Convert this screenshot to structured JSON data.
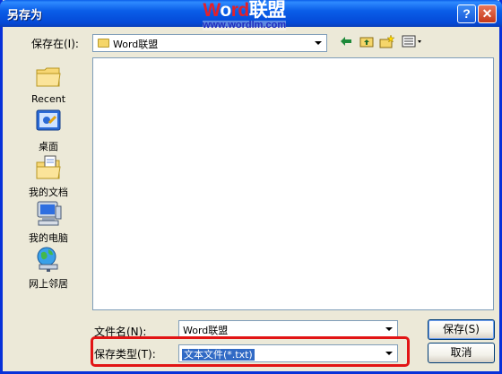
{
  "window": {
    "title": "另存为",
    "help_label": "?",
    "close_label": "✕"
  },
  "watermark": {
    "logo_w": "W",
    "logo_o": "o",
    "logo_rd": "rd",
    "logo_cn": "联盟",
    "url": "www.wordlm.com"
  },
  "save_in": {
    "label": "保存在(I):",
    "value": "Word联盟"
  },
  "toolbar": {
    "back_icon": "back-arrow-icon",
    "up_icon": "up-folder-icon",
    "new_folder_icon": "new-folder-icon",
    "views_icon": "views-menu-icon"
  },
  "places": [
    {
      "label": "Recent",
      "icon": "recent-folder-icon"
    },
    {
      "label": "桌面",
      "icon": "desktop-icon"
    },
    {
      "label": "我的文档",
      "icon": "my-documents-icon"
    },
    {
      "label": "我的电脑",
      "icon": "my-computer-icon"
    },
    {
      "label": "网上邻居",
      "icon": "network-places-icon"
    }
  ],
  "filename": {
    "label": "文件名(N):",
    "value": "Word联盟"
  },
  "filetype": {
    "label": "保存类型(T):",
    "value": "文本文件(*.txt)"
  },
  "buttons": {
    "save": "保存(S)",
    "cancel": "取消"
  },
  "colors": {
    "titlebar": "#0a5ee8",
    "highlight": "#e21414",
    "selection": "#316ac5"
  }
}
